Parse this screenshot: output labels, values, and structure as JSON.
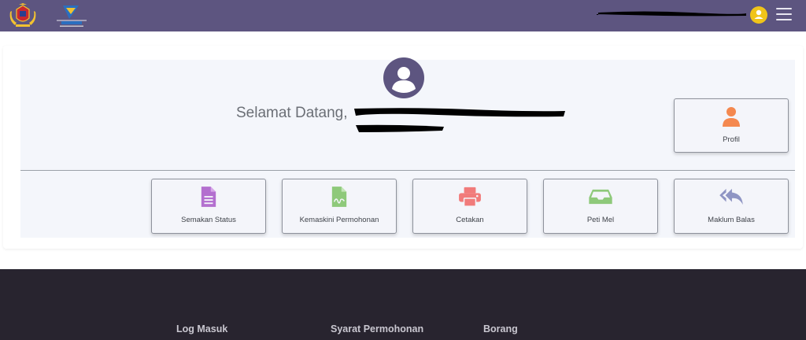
{
  "header": {
    "background_color": "#5d5580",
    "menu_icon": "hamburger-icon",
    "user_icon": "user-circle-icon",
    "user_icon_color": "#f0c419"
  },
  "welcome": {
    "greeting": "Selamat Datang,",
    "avatar_icon": "user-circle-icon",
    "avatar_color": "#5d5580"
  },
  "tiles": {
    "profil": {
      "label": "Profil",
      "icon": "user-icon",
      "color": "#f4884f"
    },
    "semakan_status": {
      "label": "Semakan Status",
      "icon": "document-icon",
      "color": "#b36fcf"
    },
    "kemaskini_permohonan": {
      "label": "Kemaskini Permohonan",
      "icon": "signed-document-icon",
      "color": "#8ec97a"
    },
    "cetakan": {
      "label": "Cetakan",
      "icon": "printer-icon",
      "color": "#f17b7b"
    },
    "peti_mel": {
      "label": "Peti Mel",
      "icon": "inbox-icon",
      "color": "#8ec97a"
    },
    "maklum_balas": {
      "label": "Maklum Balas",
      "icon": "reply-all-icon",
      "color": "#8f95c4"
    }
  },
  "footer": {
    "background_color": "#28242f",
    "links": [
      "Log Masuk",
      "Syarat Permohonan",
      "Borang"
    ]
  }
}
